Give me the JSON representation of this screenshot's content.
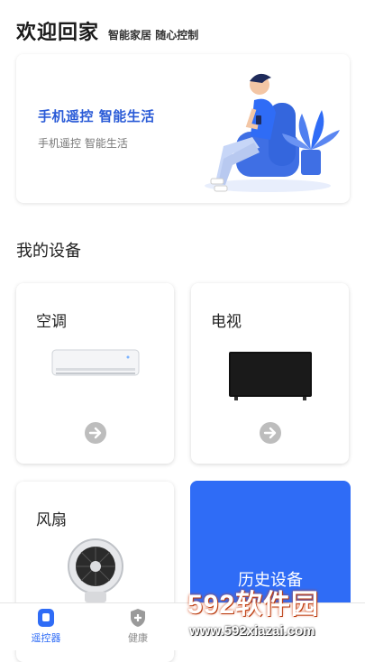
{
  "header": {
    "title": "欢迎回家",
    "subtitle": "智能家居 随心控制"
  },
  "banner": {
    "title": "手机遥控  智能生活",
    "subtitle": "手机遥控  智能生活"
  },
  "section_title": "我的设备",
  "devices": [
    {
      "label": "空调",
      "image": "air-conditioner"
    },
    {
      "label": "电视",
      "image": "television"
    },
    {
      "label": "风扇",
      "image": "fan"
    }
  ],
  "history": {
    "label": "历史设备"
  },
  "tabbar": {
    "items": [
      {
        "label": "遥控器",
        "icon": "remote-icon",
        "active": true
      },
      {
        "label": "健康",
        "icon": "health-shield-icon",
        "active": false
      }
    ]
  },
  "watermark": {
    "brand": "592软件园",
    "url": "www.592xiazai.com"
  },
  "colors": {
    "accent": "#2f6cf6",
    "banner_title": "#2a5bd7"
  }
}
